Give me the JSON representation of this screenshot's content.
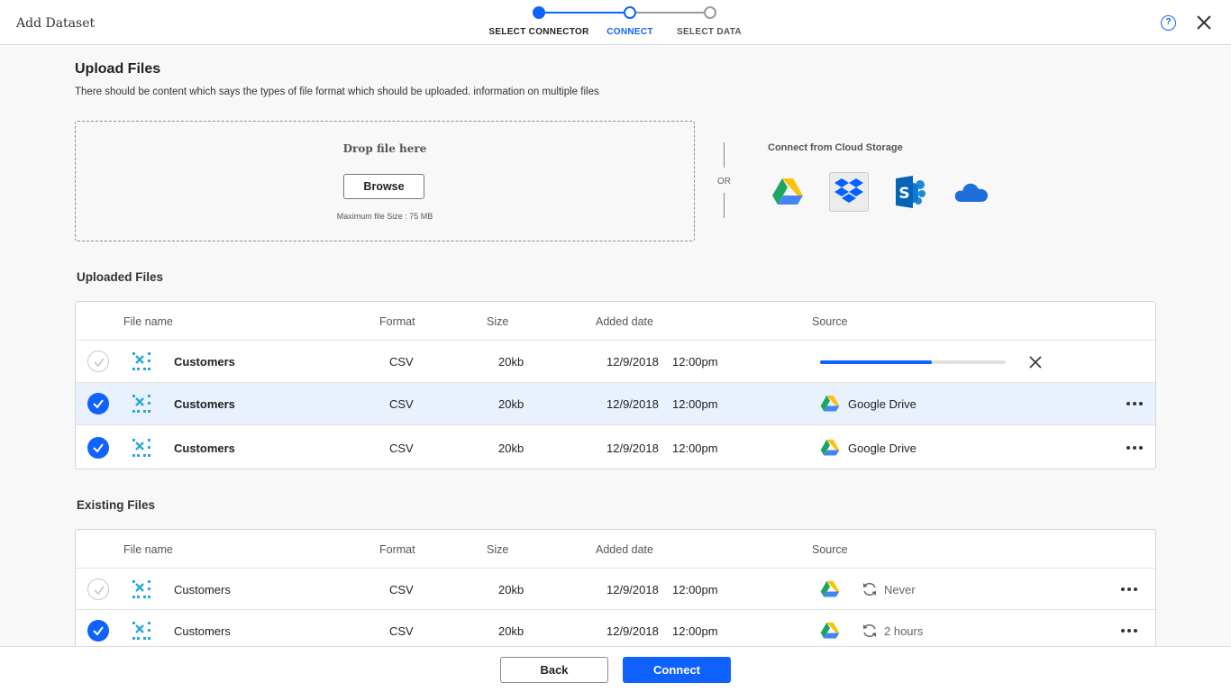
{
  "window": {
    "title": "Add Dataset"
  },
  "stepper": {
    "steps": [
      {
        "label": "SELECT CONNECTOR",
        "state": "done"
      },
      {
        "label": "CONNECT",
        "state": "active"
      },
      {
        "label": "SELECT DATA",
        "state": "pending"
      }
    ]
  },
  "header_icons": {
    "help": "question-icon",
    "help_glyph": "?",
    "close": "close-icon"
  },
  "upload": {
    "title": "Upload Files",
    "description": "There should be content which says the types of file format which should be uploaded. information on multiple files",
    "drop_text": "Drop file here",
    "browse_label": "Browse",
    "max_size": "Maximum file Size : 75 MB",
    "or_label": "OR",
    "cloud_title": "Connect from Cloud Storage",
    "cloud_providers": [
      "google-drive-icon",
      "dropbox-icon",
      "sharepoint-icon",
      "onedrive-icon"
    ],
    "selected_provider": "dropbox-icon"
  },
  "uploaded_files": {
    "title": "Uploaded Files",
    "columns": [
      "File name",
      "Format",
      "Size",
      "Added date",
      "Source"
    ],
    "rows": [
      {
        "checked": false,
        "name": "Customers",
        "format": "CSV",
        "size": "20kb",
        "date": "12/9/2018",
        "time": "12:00pm",
        "progress": 0.6,
        "source": ""
      },
      {
        "checked": true,
        "name": "Customers",
        "format": "CSV",
        "size": "20kb",
        "date": "12/9/2018",
        "time": "12:00pm",
        "source": "Google Drive"
      },
      {
        "checked": true,
        "name": "Customers",
        "format": "CSV",
        "size": "20kb",
        "date": "12/9/2018",
        "time": "12:00pm",
        "source": "Google Drive"
      }
    ]
  },
  "existing_files": {
    "title": "Existing Files",
    "columns": [
      "File name",
      "Format",
      "Size",
      "Added date",
      "Source"
    ],
    "rows": [
      {
        "checked": false,
        "name": "Customers",
        "format": "CSV",
        "size": "20kb",
        "date": "12/9/2018",
        "time": "12:00pm",
        "sync": "Never"
      },
      {
        "checked": true,
        "name": "Customers",
        "format": "CSV",
        "size": "20kb",
        "date": "12/9/2018",
        "time": "12:00pm",
        "sync": "2 hours"
      }
    ]
  },
  "footer": {
    "back_label": "Back",
    "connect_label": "Connect"
  },
  "colors": {
    "accent": "#0f62fe",
    "highlight_row": "#e9f1fd",
    "file_icon": "#29a8e0"
  }
}
